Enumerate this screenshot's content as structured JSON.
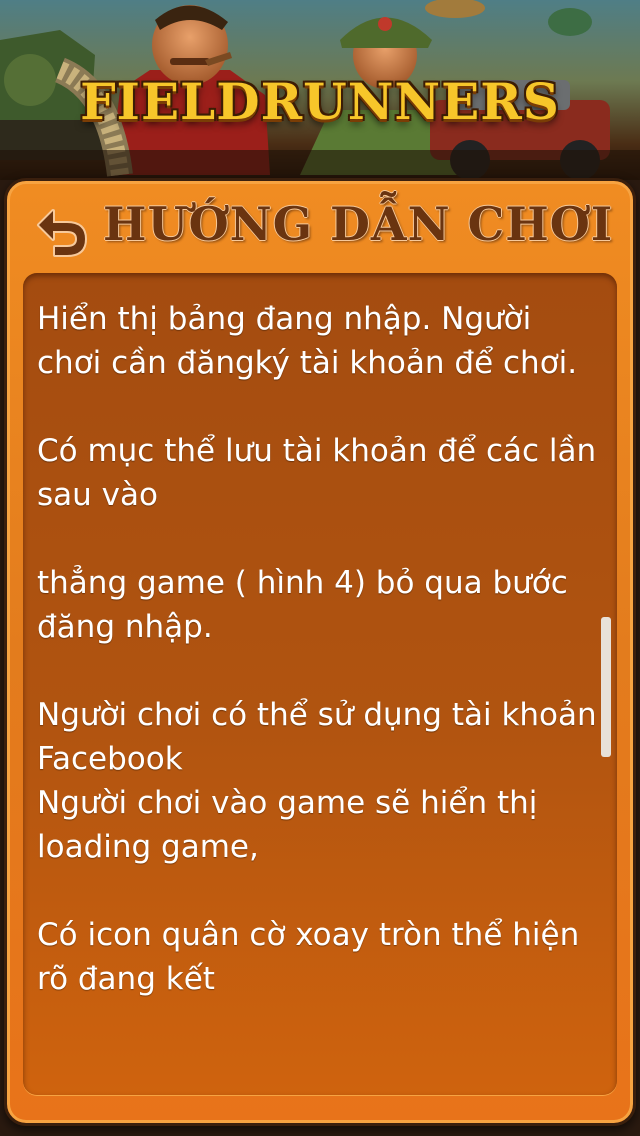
{
  "banner": {
    "logo_text": "FIELDRUNNERS"
  },
  "header": {
    "back_icon": "back-arrow-icon",
    "title": "HƯỚNG DẪN CHƠI"
  },
  "content": {
    "paragraphs": [
      "Hiển thị bảng đang nhập. Người chơi cần đăngký tài khoản để chơi.",
      "Có mục thể lưu tài khoản để các lần sau vào",
      "thẳng game ( hình 4) bỏ qua bước đăng nhập.",
      "Người chơi có thể sử dụng tài khoản Facebook",
      "Người chơi vào game sẽ hiển thị loading game,",
      "Có icon quân cờ xoay tròn thể hiện rõ đang kết"
    ]
  },
  "colors": {
    "panel_orange": "#f08c22",
    "content_brown": "#a44c10",
    "title_brown": "#6a3410",
    "logo_gold": "#f7c62a",
    "text_white": "#ffffff"
  }
}
